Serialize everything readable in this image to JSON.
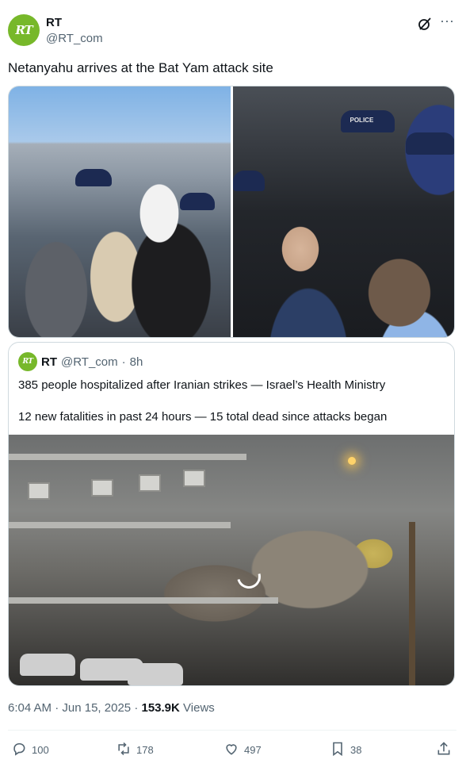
{
  "author": {
    "avatar_text": "RT",
    "display_name": "RT",
    "handle": "@RT_com"
  },
  "tweet": {
    "text": "Netanyahu arrives at the Bat Yam attack site"
  },
  "media": {
    "cap_label": "POLICE"
  },
  "quote": {
    "avatar_text": "RT",
    "name": "RT",
    "handle": "@RT_com",
    "separator": "·",
    "age": "8h",
    "line1": "385 people hospitalized after Iranian strikes — Israel’s Health Ministry",
    "line2": "12 new fatalities in past 24 hours — 15 total dead since attacks began"
  },
  "meta": {
    "time": "6:04 AM",
    "separator": "·",
    "date": "Jun 15, 2025",
    "views_count": "153.9K",
    "views_label": "Views"
  },
  "actions": {
    "replies": "100",
    "reposts": "178",
    "likes": "497",
    "bookmarks": "38"
  },
  "icons": {
    "grok": "grok-icon",
    "more": "more-icon",
    "reply": "reply-icon",
    "repost": "repost-icon",
    "like": "heart-icon",
    "bookmark": "bookmark-icon",
    "share": "share-icon"
  },
  "colors": {
    "brand": "#77b82a",
    "text_primary": "#0f1419",
    "text_secondary": "#536471",
    "border": "#cfd9de"
  }
}
